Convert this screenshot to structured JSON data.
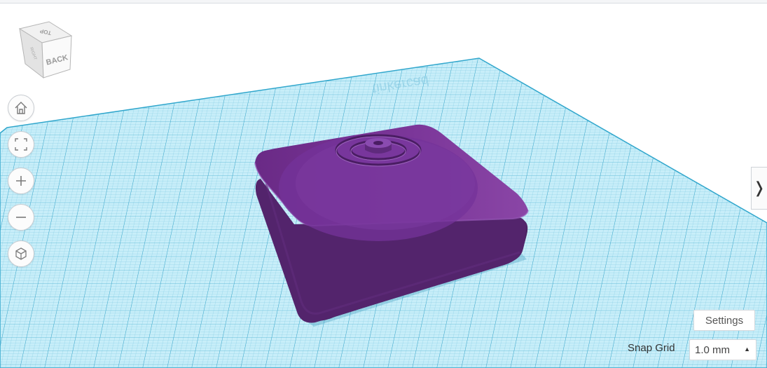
{
  "viewcube": {
    "face_front": "BACK",
    "face_top": "TOP",
    "face_side": "RIGHT"
  },
  "nav_buttons": [
    {
      "name": "home-view-button",
      "icon": "home-icon"
    },
    {
      "name": "fit-view-button",
      "icon": "fit-to-view-icon"
    },
    {
      "name": "zoom-in-button",
      "icon": "plus-icon"
    },
    {
      "name": "zoom-out-button",
      "icon": "minus-icon"
    },
    {
      "name": "projection-toggle-button",
      "icon": "perspective-cube-icon"
    }
  ],
  "workplane": {
    "watermark": "tinkercad",
    "grid_color": "#4db8d8",
    "plane_color": "#c4ecf8"
  },
  "model": {
    "color": "#7a3696",
    "shape": "rounded square base with concentric rings"
  },
  "panel_toggle": {
    "glyph": "❭"
  },
  "settings": {
    "label": "Settings"
  },
  "snap_grid": {
    "label": "Snap Grid",
    "value": "1.0 mm"
  }
}
